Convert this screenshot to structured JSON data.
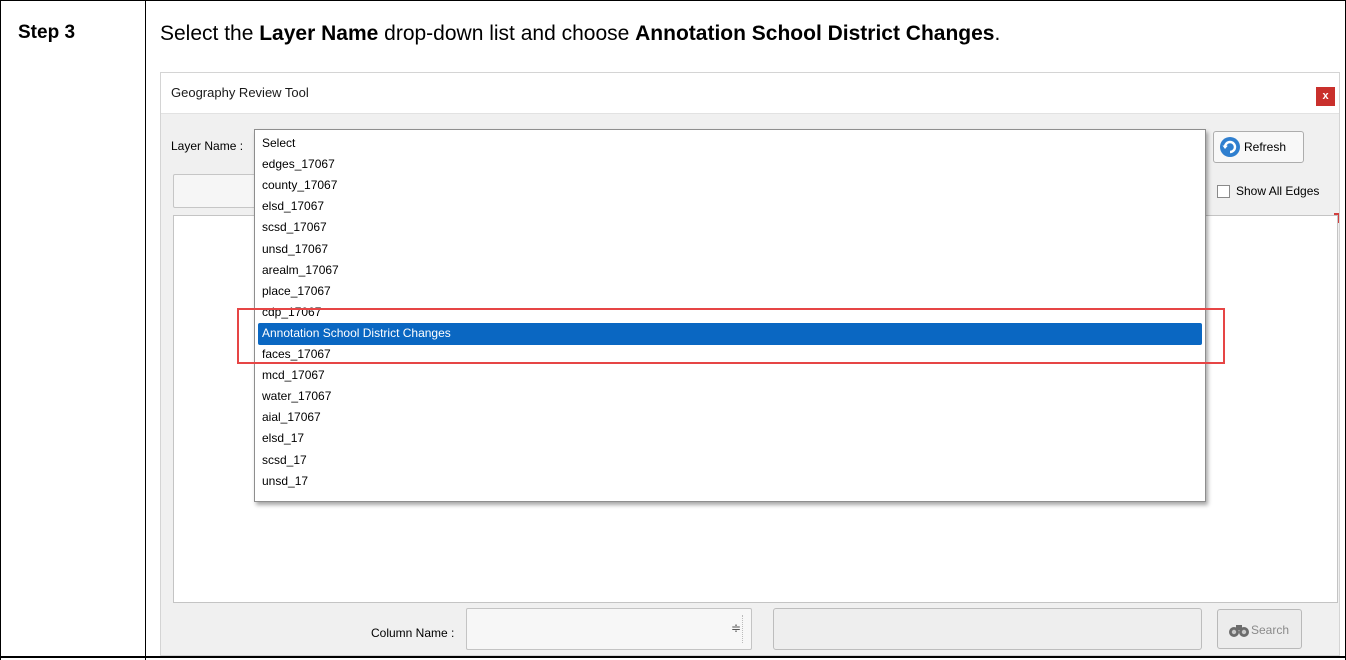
{
  "document": {
    "step_label": "Step 3",
    "instruction": {
      "prefix": "Select the ",
      "bold1": "Layer Name",
      "middle": " drop-down list and choose ",
      "bold2": "Annotation School District Changes",
      "suffix": "."
    }
  },
  "window": {
    "title": "Geography Review Tool",
    "close_label": "x",
    "layer_name_label": "Layer Name :",
    "refresh_label": "Refresh",
    "show_all_edges_label": "Show All Edges",
    "show_all_edges_checked": false,
    "column_name_label": "Column Name :",
    "column_combo_arrows": "≑",
    "search_label": "Search"
  },
  "dropdown": {
    "items": [
      "Select",
      "edges_17067",
      "county_17067",
      "elsd_17067",
      "scsd_17067",
      "unsd_17067",
      "arealm_17067",
      "place_17067",
      "cdp_17067",
      "Annotation School District Changes",
      "faces_17067",
      "mcd_17067",
      "water_17067",
      "aial_17067",
      "elsd_17",
      "scsd_17",
      "unsd_17"
    ],
    "selected_index": 9
  },
  "colors": {
    "selection": "#0a67c2",
    "highlight_box": "#e64545",
    "close_button": "#c9302c",
    "refresh_icon": "#2f7fcf"
  }
}
